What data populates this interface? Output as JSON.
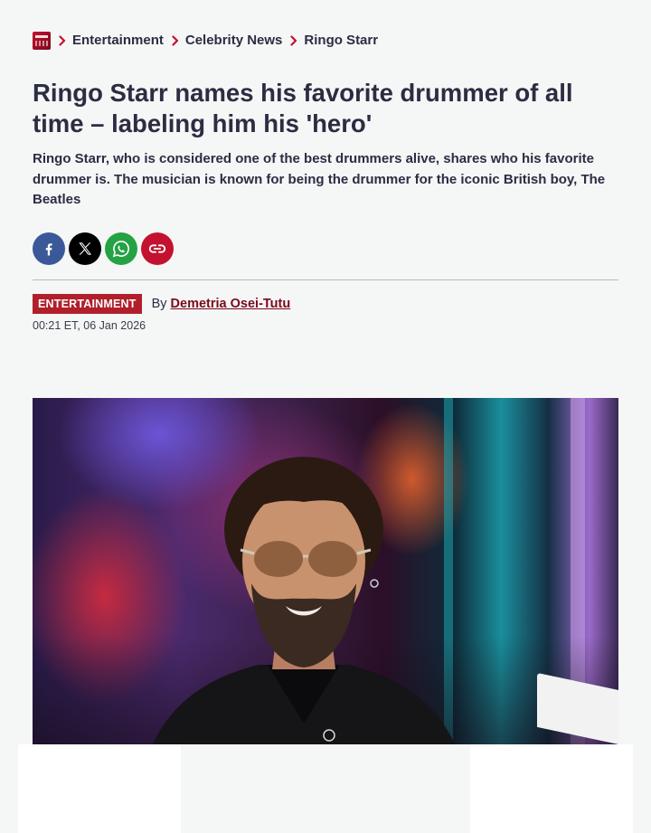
{
  "breadcrumb": {
    "logo_icon": "site-logo-icon",
    "items": [
      "Entertainment",
      "Celebrity News",
      "Ringo Starr"
    ]
  },
  "article": {
    "headline": "Ringo Starr names his favorite drummer of all time – labeling him his 'hero'",
    "standfirst": "Ringo Starr, who is considered one of the best drummers alive, shares who his favorite drummer is. The musician is known for being the drummer for the iconic British boy, The Beatles",
    "section_tag": "ENTERTAINMENT",
    "by_label": "By",
    "author": "Demetria Osei-Tutu",
    "timestamp": "00:21 ET, 06 Jan 2026"
  },
  "share": {
    "buttons": [
      {
        "icon": "facebook-icon",
        "color": "#3b5998"
      },
      {
        "icon": "x-icon",
        "color": "#000000"
      },
      {
        "icon": "whatsapp-icon",
        "color": "#25a244"
      },
      {
        "icon": "link-icon",
        "color": "#c4112f"
      }
    ]
  },
  "colors": {
    "accent": "#c4112f",
    "tag_bg": "#b01f2b",
    "author": "#7a0a1b",
    "text": "#2b2d42",
    "background": "#f5f6f6"
  }
}
